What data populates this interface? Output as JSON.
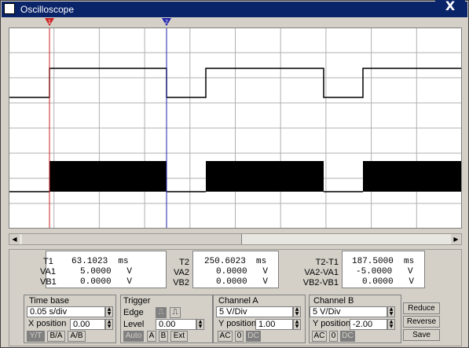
{
  "window": {
    "title": "Oscilloscope",
    "close_glyph": "X"
  },
  "markers": [
    {
      "id": "T1",
      "label": "1",
      "color": "#cc2222"
    },
    {
      "id": "T2",
      "label": "2",
      "color": "#2222aa"
    }
  ],
  "readouts": [
    {
      "labels": [
        "T1",
        "VA1",
        "VB1"
      ],
      "values": [
        "63.1023  ms",
        "5.0000   V",
        "0.0000   V"
      ]
    },
    {
      "labels": [
        "T2",
        "VA2",
        "VB2"
      ],
      "values": [
        "250.6023  ms",
        "0.0000   V",
        "0.0000   V"
      ]
    },
    {
      "labels": [
        "T2-T1",
        "VA2-VA1",
        "VB2-VB1"
      ],
      "values": [
        "187.5000  ms",
        "-5.0000   V",
        "0.0000   V"
      ]
    }
  ],
  "timebase": {
    "title": "Time base",
    "value": "0.05 s/div",
    "xpos_label": "X position",
    "xpos_value": "0.00",
    "modes": [
      "Y/T",
      "B/A",
      "A/B"
    ]
  },
  "trigger": {
    "title": "Trigger",
    "edge_label": "Edge",
    "level_label": "Level",
    "level_value": "0.00",
    "sources": [
      "Auto",
      "A",
      "B",
      "Ext"
    ]
  },
  "channel_a": {
    "title": "Channel A",
    "value": "5 V/Div",
    "ypos_label": "Y position",
    "ypos_value": "1.00",
    "coupling": [
      "AC",
      "0",
      "DC"
    ]
  },
  "channel_b": {
    "title": "Channel B",
    "value": "5 V/Div",
    "ypos_label": "Y position",
    "ypos_value": "-2.00",
    "coupling": [
      "AC",
      "0",
      "DC"
    ]
  },
  "actions": [
    "Reduce",
    "Reverse",
    "Save"
  ],
  "colors": {
    "screen": "#ffffff",
    "grid": "#b0b0b0",
    "trace": "#000000",
    "titlebar": "#0a246a",
    "panel": "#d4d0c8"
  },
  "icons": [
    "window-icon",
    "close-icon",
    "scroll-left-icon",
    "scroll-right-icon",
    "spin-up-icon",
    "spin-down-icon",
    "rising-edge-icon",
    "falling-edge-icon"
  ]
}
